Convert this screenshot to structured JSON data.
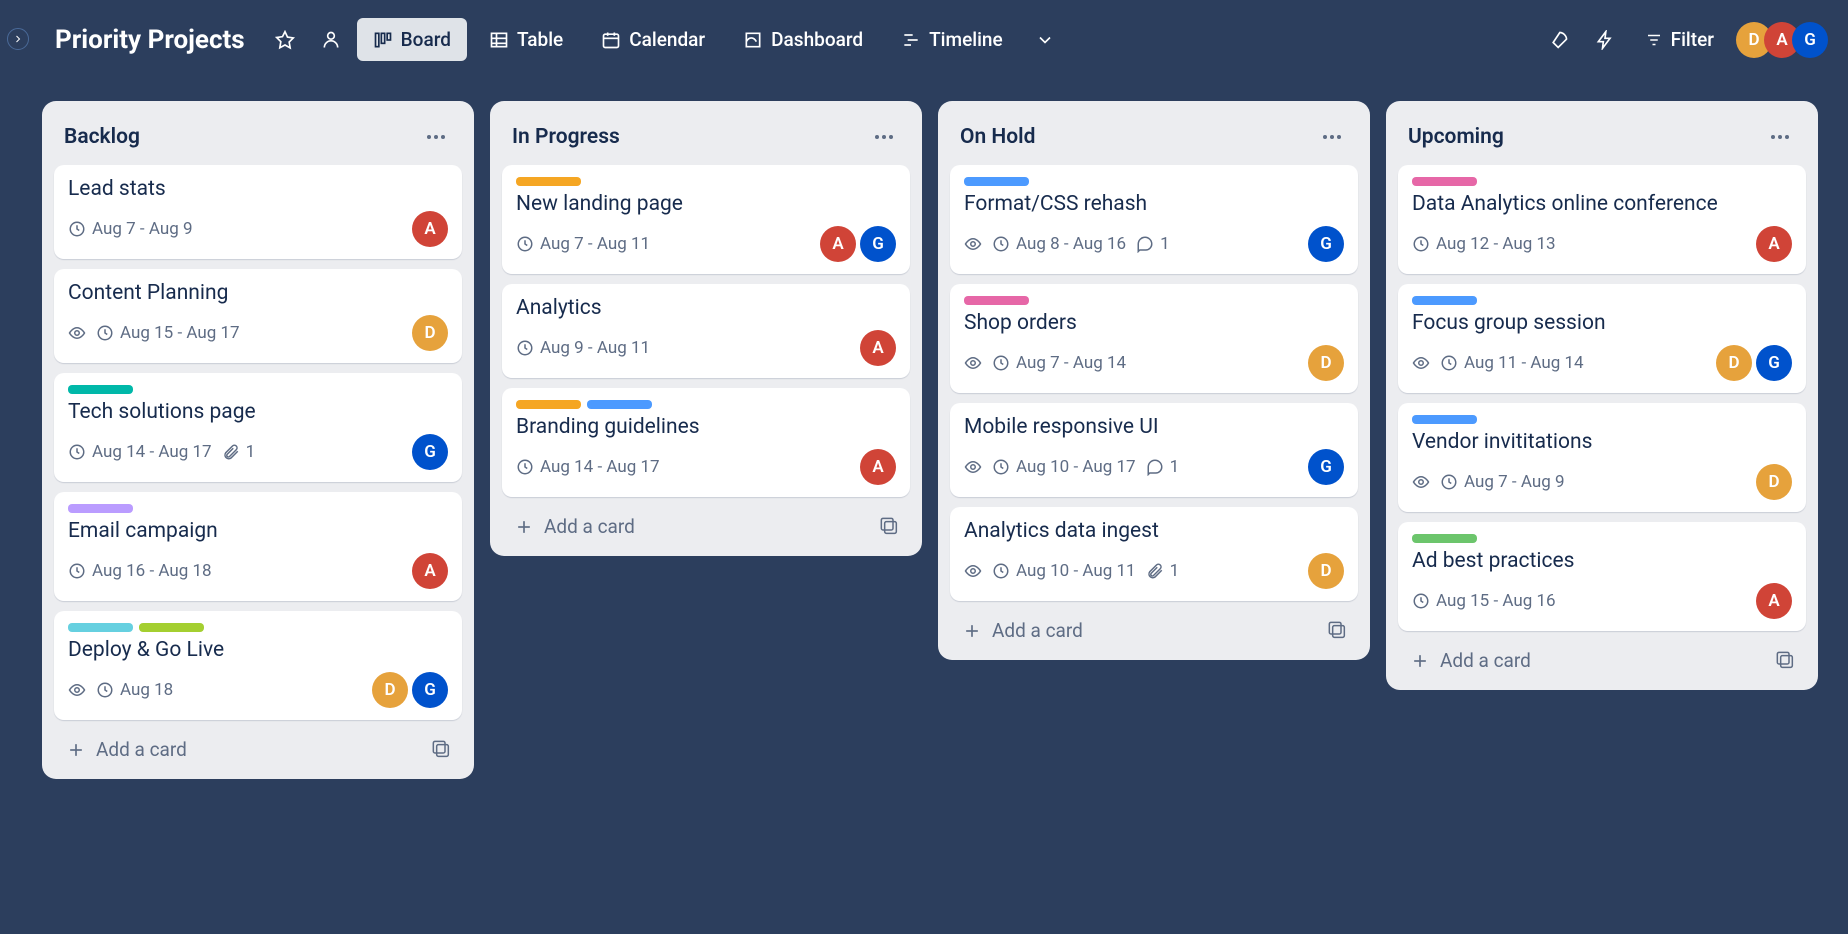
{
  "board_title": "Priority Projects",
  "views": {
    "board": "Board",
    "table": "Table",
    "calendar": "Calendar",
    "dashboard": "Dashboard",
    "timeline": "Timeline"
  },
  "filter_label": "Filter",
  "header_avatars": [
    "D",
    "A",
    "G"
  ],
  "add_card_label": "Add a card",
  "columns": {
    "backlog": {
      "title": "Backlog",
      "cards": {
        "c0": {
          "title": "Lead stats",
          "date": "Aug 7 - Aug 9"
        },
        "c1": {
          "title": "Content Planning",
          "date": "Aug 15 - Aug 17"
        },
        "c2": {
          "title": "Tech solutions page",
          "date": "Aug 14 - Aug 17",
          "attach": "1"
        },
        "c3": {
          "title": "Email campaign",
          "date": "Aug 16 - Aug 18"
        },
        "c4": {
          "title": "Deploy & Go Live",
          "date": "Aug 18"
        }
      }
    },
    "progress": {
      "title": "In Progress",
      "cards": {
        "c0": {
          "title": "New landing page",
          "date": "Aug 7 - Aug 11"
        },
        "c1": {
          "title": "Analytics",
          "date": "Aug 9 - Aug 11"
        },
        "c2": {
          "title": "Branding guidelines",
          "date": "Aug 14 - Aug 17"
        }
      }
    },
    "hold": {
      "title": "On Hold",
      "cards": {
        "c0": {
          "title": "Format/CSS rehash",
          "date": "Aug 8 - Aug 16",
          "comments": "1"
        },
        "c1": {
          "title": "Shop orders",
          "date": "Aug 7 - Aug 14"
        },
        "c2": {
          "title": "Mobile responsive UI",
          "date": "Aug 10 - Aug 17",
          "comments": "1"
        },
        "c3": {
          "title": "Analytics data ingest",
          "date": "Aug 10 - Aug 11",
          "attach": "1"
        }
      }
    },
    "upcoming": {
      "title": "Upcoming",
      "cards": {
        "c0": {
          "title": "Data Analytics online conference",
          "date": "Aug 12 - Aug 13"
        },
        "c1": {
          "title": "Focus group session",
          "date": "Aug 11 - Aug 14"
        },
        "c2": {
          "title": "Vendor invititations",
          "date": "Aug 7 - Aug 9"
        },
        "c3": {
          "title": "Ad best practices",
          "date": "Aug 15 - Aug 16"
        }
      }
    }
  }
}
